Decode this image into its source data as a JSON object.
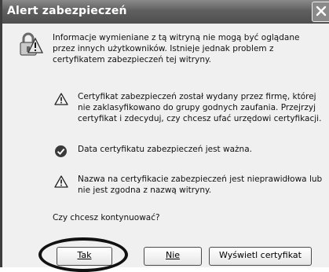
{
  "window": {
    "title": "Alert zabezpieczeń"
  },
  "header": {
    "message": "Informacje wymieniane z tą witryną nie mogą być oglądane przez innych użytkowników. Istnieje jednak problem z certyfikatem zabezpieczeń tej witryny.",
    "icon": "lock-warning-icon"
  },
  "items": [
    {
      "icon": "warning-icon",
      "text": "Certyfikat zabezpieczeń został wydany przez firmę, której nie zaklasyfikowano do grupy godnych zaufania. Przejrzyj certyfikat i zdecyduj, czy chcesz ufać urzędowi certyfikacji."
    },
    {
      "icon": "check-icon",
      "text": "Data certyfikatu zabezpieczeń jest ważna."
    },
    {
      "icon": "warning-icon",
      "text": "Nazwa na certyfikacie zabezpieczeń jest nieprawidłowa lub nie jest zgodna z nazwą witryny."
    }
  ],
  "question": "Czy chcesz kontynuować?",
  "buttons": {
    "yes": "Tak",
    "no": "Nie",
    "view_certificate": "Wyświetl certyfikat"
  }
}
